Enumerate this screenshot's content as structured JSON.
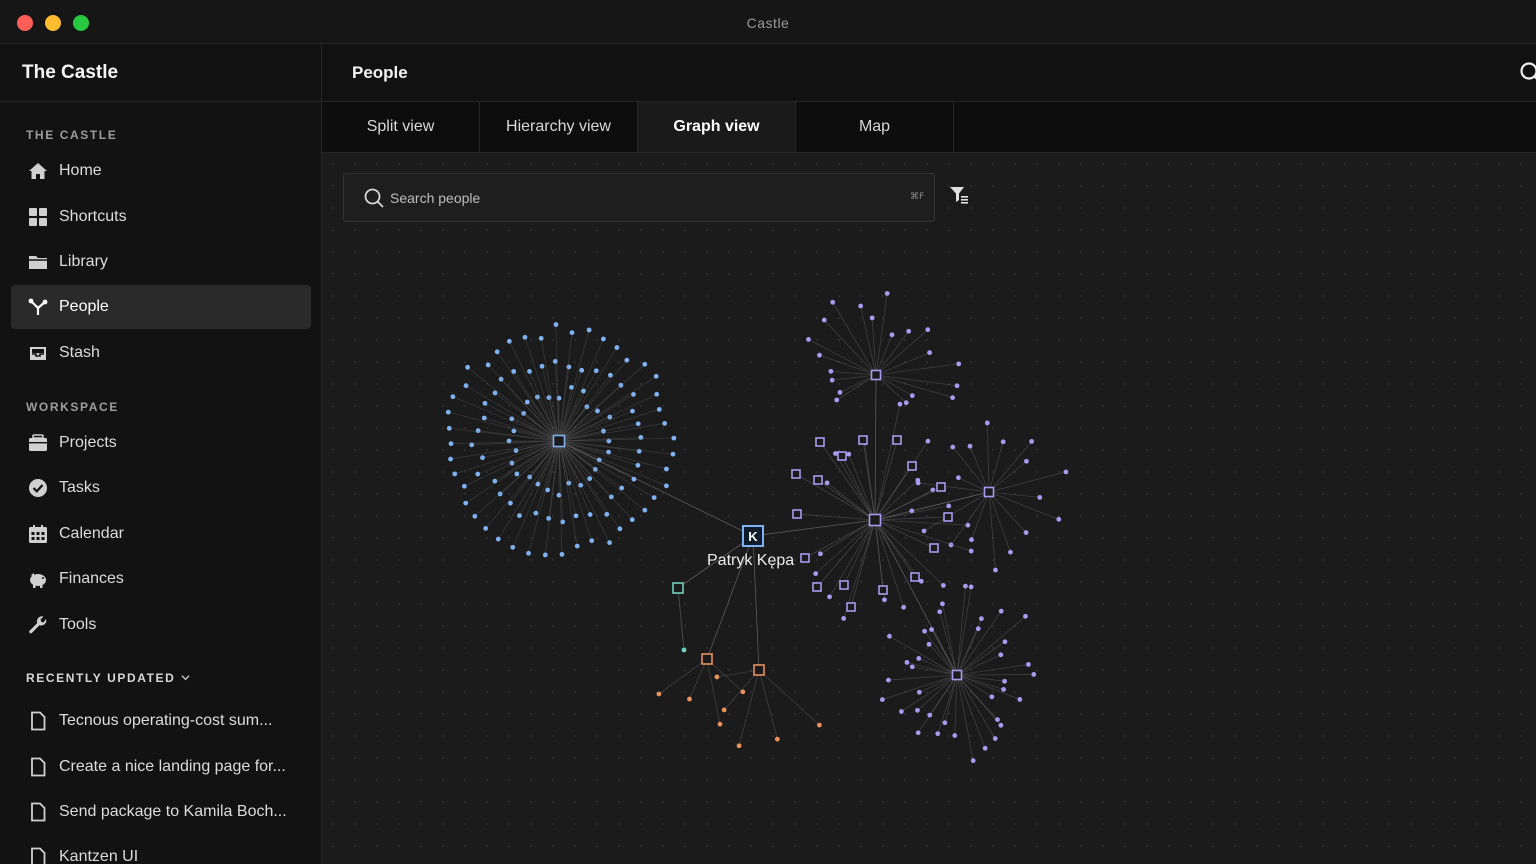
{
  "window": {
    "title": "Castle"
  },
  "sidebar": {
    "app_name": "The Castle",
    "section_main": "THE CASTLE",
    "section_workspace": "WORKSPACE",
    "section_recent": "RECENTLY UPDATED",
    "main_items": [
      {
        "label": "Home",
        "icon": "home-icon"
      },
      {
        "label": "Shortcuts",
        "icon": "grid-icon"
      },
      {
        "label": "Library",
        "icon": "folder-icon"
      },
      {
        "label": "People",
        "icon": "people-graph-icon",
        "active": true
      },
      {
        "label": "Stash",
        "icon": "inbox-icon"
      }
    ],
    "workspace_items": [
      {
        "label": "Projects",
        "icon": "briefcase-icon"
      },
      {
        "label": "Tasks",
        "icon": "check-circle-icon"
      },
      {
        "label": "Calendar",
        "icon": "calendar-icon"
      },
      {
        "label": "Finances",
        "icon": "piggy-bank-icon"
      },
      {
        "label": "Tools",
        "icon": "wrench-icon"
      }
    ],
    "recent_items": [
      {
        "label": "Tecnous operating-cost sum...",
        "icon": "document-icon"
      },
      {
        "label": "Create a nice landing page for...",
        "icon": "document-icon"
      },
      {
        "label": "Send package to Kamila Boch...",
        "icon": "document-icon"
      },
      {
        "label": "Kantzen UI",
        "icon": "document-icon"
      }
    ]
  },
  "header": {
    "title": "People"
  },
  "tabs": [
    {
      "label": "Split view"
    },
    {
      "label": "Hierarchy view"
    },
    {
      "label": "Graph view",
      "active": true
    },
    {
      "label": "Map"
    }
  ],
  "search": {
    "placeholder": "Search people",
    "shortcut": "⌘F"
  },
  "graph": {
    "focus_label": "Patryk Kępa",
    "colors": {
      "blue": "#7fb2f0",
      "purple": "#a99af0",
      "orange": "#e8935a",
      "teal": "#6fd0c0",
      "edge": "#6a6a6a"
    }
  }
}
